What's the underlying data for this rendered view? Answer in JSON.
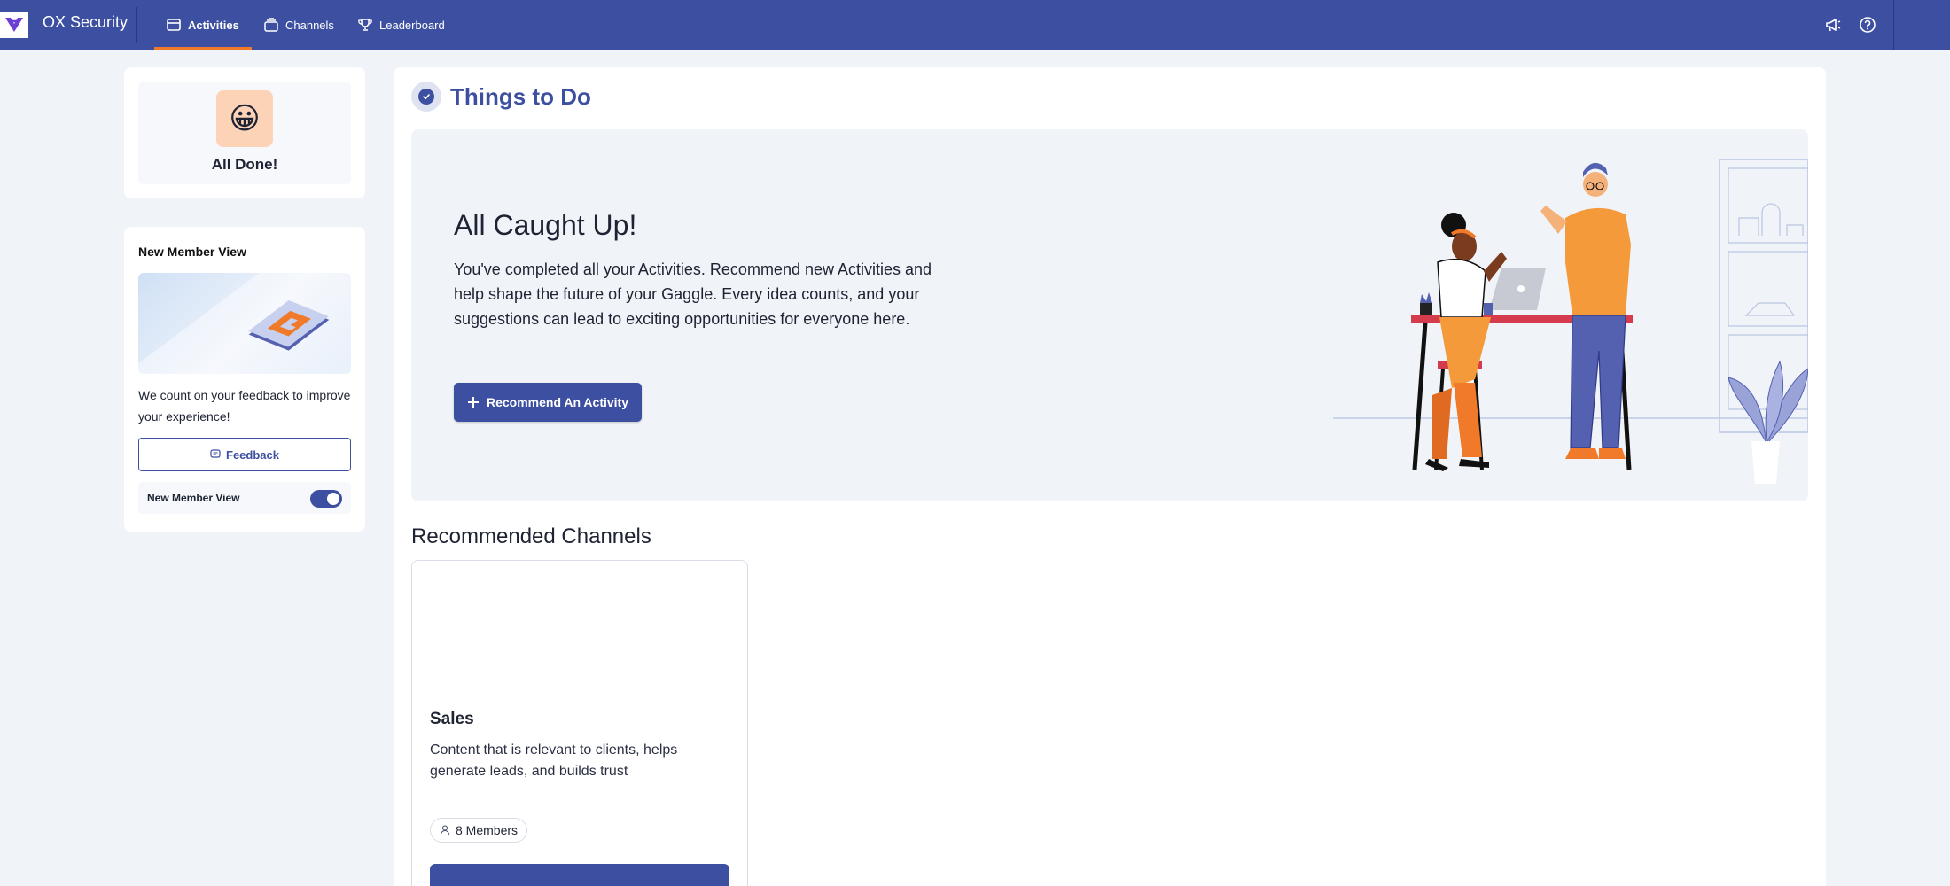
{
  "app": {
    "org_name": "OX Security"
  },
  "nav": {
    "activities": "Activities",
    "channels": "Channels",
    "leaderboard": "Leaderboard"
  },
  "status": {
    "emoji": "😀",
    "label": "All Done!"
  },
  "member_view": {
    "title": "New Member View",
    "text": "We count on your feedback to improve your experience!",
    "feedback_label": "Feedback",
    "toggle_label": "New Member View",
    "toggle_on": true
  },
  "main": {
    "section_title": "Things to Do",
    "hero_title": "All Caught Up!",
    "hero_text": "You've completed all your Activities. Recommend new Activities and help shape the future of your Gaggle. Every idea counts, and your suggestions can lead to exciting opportunities for everyone here.",
    "recommend_label": "Recommend An Activity",
    "recommended_title": "Recommended Channels",
    "channel": {
      "name": "Sales",
      "description": "Content that is relevant to clients, helps generate leads, and builds trust",
      "members": "8 Members"
    }
  },
  "colors": {
    "brand": "#3d4fa0",
    "accent": "#f07a2a",
    "background": "#f0f3f7"
  },
  "icons": [
    "logo-icon",
    "activities-icon",
    "channels-icon",
    "trophy-icon",
    "megaphone-icon",
    "help-icon",
    "check-icon",
    "feedback-icon",
    "plus-icon",
    "user-icon"
  ]
}
